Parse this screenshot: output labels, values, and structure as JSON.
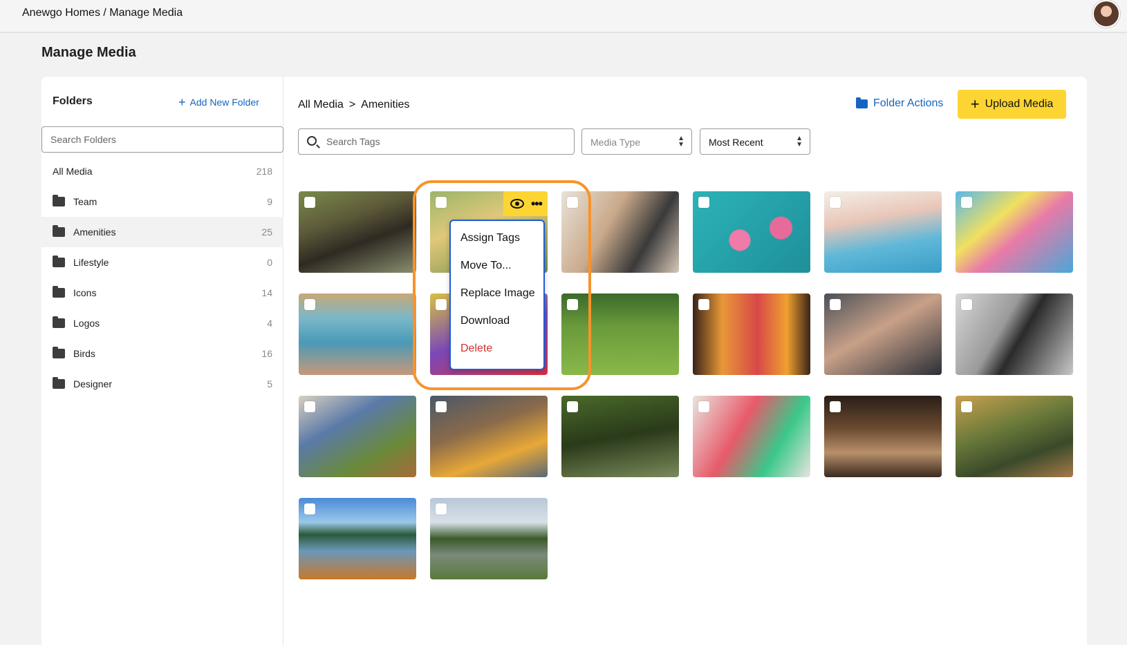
{
  "app": {
    "breadcrumb_title": "Anewgo Homes / Manage Media"
  },
  "page": {
    "title": "Manage Media"
  },
  "sidebar": {
    "title": "Folders",
    "add_label": "Add New Folder",
    "search_placeholder": "Search Folders",
    "items": [
      {
        "label": "All Media",
        "count": "218"
      },
      {
        "label": "Team",
        "count": "9"
      },
      {
        "label": "Amenities",
        "count": "25"
      },
      {
        "label": "Lifestyle",
        "count": "0"
      },
      {
        "label": "Icons",
        "count": "14"
      },
      {
        "label": "Logos",
        "count": "4"
      },
      {
        "label": "Birds",
        "count": "16"
      },
      {
        "label": "Designer",
        "count": "5"
      }
    ]
  },
  "main": {
    "breadcrumb": {
      "root": "All Media",
      "separator": ">",
      "current": "Amenities"
    },
    "folder_actions_label": "Folder Actions",
    "upload_label": "Upload Media",
    "search_tags_placeholder": "Search Tags",
    "media_type_placeholder": "Media Type",
    "sort_value": "Most Recent"
  },
  "context_menu": {
    "items": [
      {
        "label": "Assign Tags"
      },
      {
        "label": "Move To..."
      },
      {
        "label": "Replace Image"
      },
      {
        "label": "Download"
      },
      {
        "label": "Delete"
      }
    ]
  },
  "media": [
    {
      "subject": "boardwalk-forest"
    },
    {
      "subject": "pool-lounger"
    },
    {
      "subject": "shopping-couple"
    },
    {
      "subject": "pool-floats"
    },
    {
      "subject": "family-pool"
    },
    {
      "subject": "waterslide-kid"
    },
    {
      "subject": "hot-tub"
    },
    {
      "subject": "playground"
    },
    {
      "subject": "kids-soccer"
    },
    {
      "subject": "cocktails"
    },
    {
      "subject": "fitness-class"
    },
    {
      "subject": "gym-machine"
    },
    {
      "subject": "farmers-market"
    },
    {
      "subject": "shopping-woman"
    },
    {
      "subject": "hiking-creek"
    },
    {
      "subject": "friends-shopping"
    },
    {
      "subject": "outdoor-dinner"
    },
    {
      "subject": "picnic-family"
    },
    {
      "subject": "lake-chairs"
    },
    {
      "subject": "park-pond"
    }
  ],
  "colors": {
    "accent_yellow": "#fcd532",
    "link_blue": "#1565c0",
    "highlight_orange": "#f7932b",
    "danger_red": "#d32f2f"
  }
}
